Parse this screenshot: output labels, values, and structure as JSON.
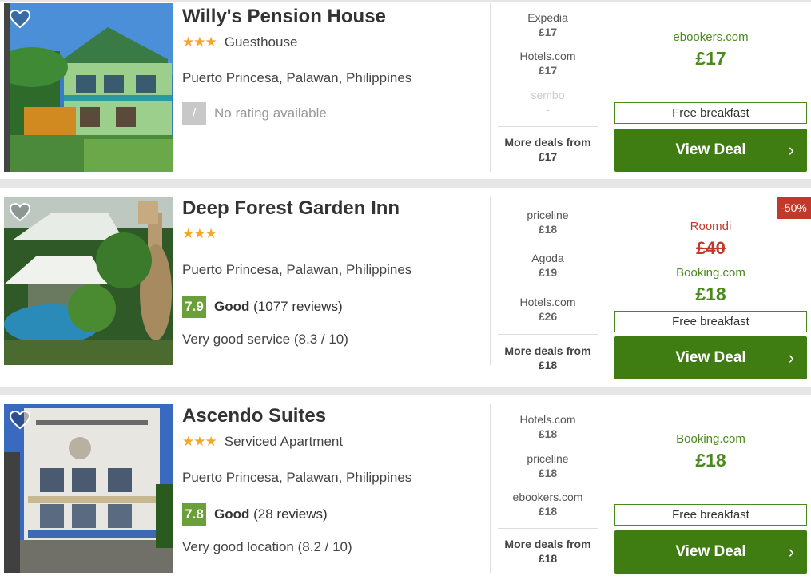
{
  "hotels": [
    {
      "name": "Willy's Pension House",
      "stars": "★★★",
      "type": "Guesthouse",
      "location": "Puerto Princesa, Palawan, Philippines",
      "score": "/",
      "rating_label": "",
      "reviews": "No rating available",
      "subtext": "",
      "deals": [
        {
          "provider": "Expedia",
          "price": "£17"
        },
        {
          "provider": "Hotels.com",
          "price": "£17"
        },
        {
          "provider": "sembo",
          "price": "-"
        }
      ],
      "more_deals_label": "More deals from",
      "more_deals_price": "£17",
      "best_provider": "ebookers.com",
      "old_provider": "",
      "old_price": "",
      "best_price": "£17",
      "breakfast": "Free breakfast",
      "view_deal": "View Deal",
      "discount": ""
    },
    {
      "name": "Deep Forest Garden Inn",
      "stars": "★★★",
      "type": "",
      "location": "Puerto Princesa, Palawan, Philippines",
      "score": "7.9",
      "rating_label": "Good",
      "reviews": "(1077 reviews)",
      "subtext": "Very good service (8.3 / 10)",
      "deals": [
        {
          "provider": "priceline",
          "price": "£18"
        },
        {
          "provider": "Agoda",
          "price": "£19"
        },
        {
          "provider": "Hotels.com",
          "price": "£26"
        }
      ],
      "more_deals_label": "More deals from",
      "more_deals_price": "£18",
      "best_provider": "Booking.com",
      "old_provider": "Roomdi",
      "old_price": "£40",
      "best_price": "£18",
      "breakfast": "Free breakfast",
      "view_deal": "View Deal",
      "discount": "-50%"
    },
    {
      "name": "Ascendo Suites",
      "stars": "★★★",
      "type": "Serviced Apartment",
      "location": "Puerto Princesa, Palawan, Philippines",
      "score": "7.8",
      "rating_label": "Good",
      "reviews": "(28 reviews)",
      "subtext": "Very good location (8.2 / 10)",
      "deals": [
        {
          "provider": "Hotels.com",
          "price": "£18"
        },
        {
          "provider": "priceline",
          "price": "£18"
        },
        {
          "provider": "ebookers.com",
          "price": "£18"
        }
      ],
      "more_deals_label": "More deals from",
      "more_deals_price": "£18",
      "best_provider": "Booking.com",
      "old_provider": "",
      "old_price": "",
      "best_price": "£18",
      "breakfast": "Free breakfast",
      "view_deal": "View Deal",
      "discount": ""
    }
  ],
  "colors": {
    "accent_green": "#3f7d12",
    "price_green": "#4a8a1c",
    "rating_green": "#6a9f3a",
    "discount_red": "#c0392b",
    "star_orange": "#f5a623"
  }
}
